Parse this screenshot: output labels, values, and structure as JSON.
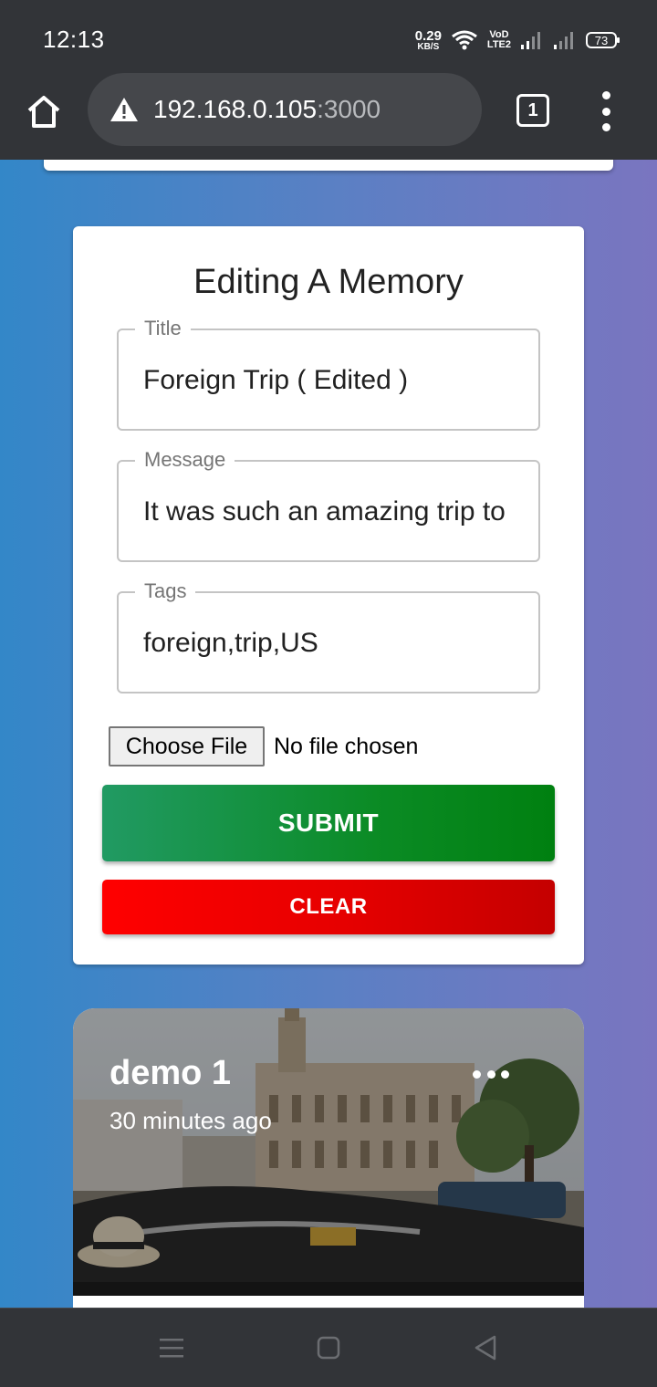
{
  "status_bar": {
    "time": "12:13",
    "net_speed_value": "0.29",
    "net_speed_unit": "KB/S",
    "volte_top": "VoD",
    "volte_bottom": "LTE2",
    "battery": "73",
    "icons": [
      "wifi-icon",
      "signal-icon",
      "signal-icon",
      "battery-icon"
    ]
  },
  "browser": {
    "url_host": "192.168.0.105",
    "url_port": ":3000",
    "tab_count": "1",
    "icons": [
      "home-icon",
      "warning-icon",
      "tabs-icon",
      "more-vert-icon"
    ]
  },
  "form": {
    "heading": "Editing A Memory",
    "title_label": "Title",
    "title_value": "Foreign Trip ( Edited )",
    "message_label": "Message",
    "message_value": "It was such an amazing trip to",
    "tags_label": "Tags",
    "tags_value": "foreign,trip,US",
    "file_button": "Choose File",
    "file_status": "No file chosen",
    "submit_label": "SUBMIT",
    "clear_label": "CLEAR"
  },
  "post": {
    "title": "demo 1",
    "time": "30 minutes ago",
    "image": "street-with-vintage-car-photo"
  },
  "nav": {
    "icons": [
      "recents-icon",
      "home-square-icon",
      "back-icon"
    ]
  },
  "colors": {
    "system_bar": "#323438",
    "page_gradient_start": "#3387c8",
    "page_gradient_end": "#7a75c0",
    "submit_green": "#0b8b25",
    "clear_red": "#e50000"
  }
}
